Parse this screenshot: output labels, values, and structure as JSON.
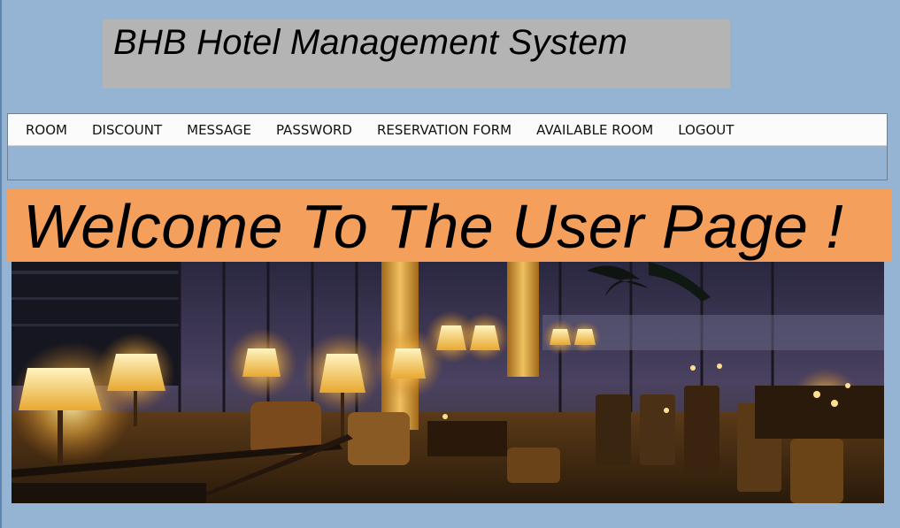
{
  "header": {
    "title": "BHB Hotel Management System"
  },
  "menu": {
    "items": [
      {
        "label": "ROOM"
      },
      {
        "label": "DISCOUNT"
      },
      {
        "label": "MESSAGE"
      },
      {
        "label": "PASSWORD"
      },
      {
        "label": "RESERVATION FORM"
      },
      {
        "label": "AVAILABLE ROOM"
      },
      {
        "label": "LOGOUT"
      }
    ]
  },
  "main": {
    "welcome": "Welcome To The User Page !",
    "image_subject": "hotel-lounge-photo"
  },
  "colors": {
    "background": "#95b3d2",
    "title_panel": "#b4b4b4",
    "welcome_panel": "#f4a05c",
    "menu_strip": "#fbfbfb"
  }
}
